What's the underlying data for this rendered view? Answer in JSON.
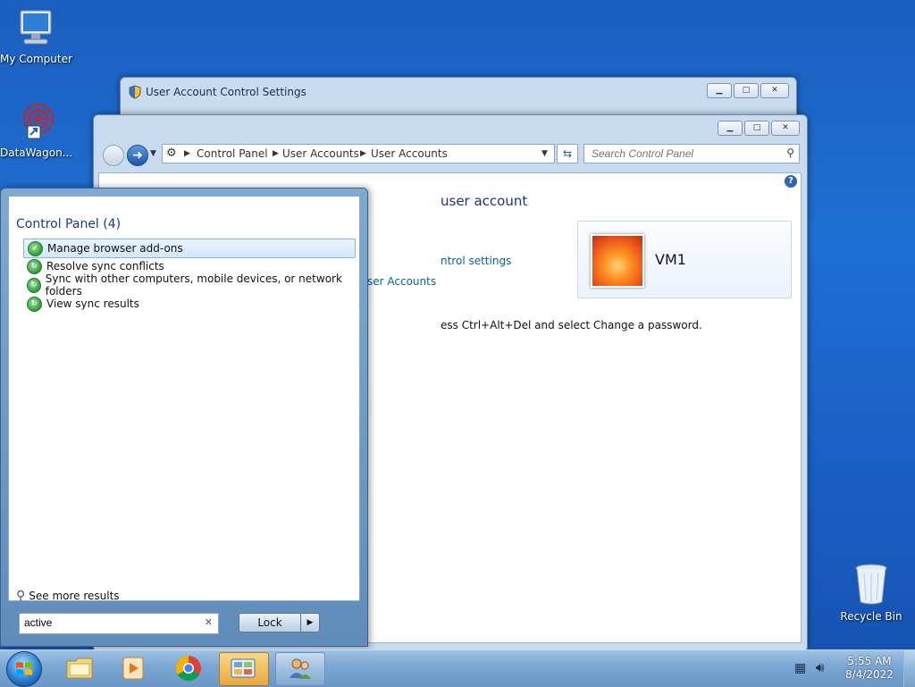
{
  "desktop": {
    "icons": [
      {
        "label": "My Computer"
      },
      {
        "label": "DataWagon..."
      },
      {
        "label": "Recycle Bin"
      }
    ]
  },
  "uac_window": {
    "title": "User Account Control Settings"
  },
  "cp_window": {
    "breadcrumb": [
      "Control Panel",
      "User Accounts",
      "User Accounts"
    ],
    "search_placeholder": "Search Control Panel",
    "heading_partial": "user account",
    "link_control_settings": "ntrol settings",
    "link_user_accounts": "ser Accounts",
    "password_hint": "ess Ctrl+Alt+Del and select Change a password.",
    "account_name": "VM1"
  },
  "start_menu": {
    "group_heading": "Control Panel (4)",
    "results": [
      {
        "label": "Manage browser add-ons",
        "selected": true
      },
      {
        "label": "Resolve sync conflicts",
        "selected": false
      },
      {
        "label": "Sync with other computers, mobile devices, or network folders",
        "selected": false
      },
      {
        "label": "View sync results",
        "selected": false
      }
    ],
    "see_more": "See more results",
    "search_value": "active",
    "lock_label": "Lock"
  },
  "taskbar": {
    "time": "5:55 AM",
    "date": "8/4/2022"
  }
}
